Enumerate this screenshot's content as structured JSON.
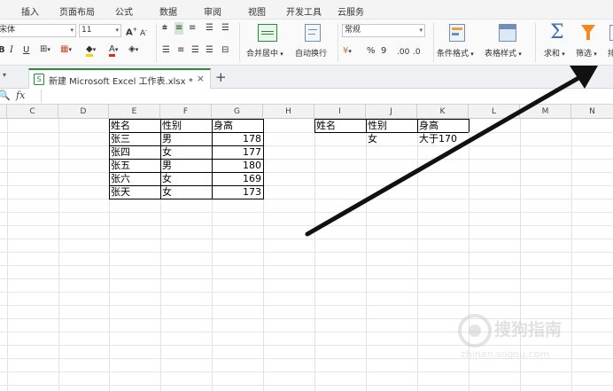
{
  "menu": [
    "插入",
    "页面布局",
    "公式",
    "数据",
    "审阅",
    "视图",
    "开发工具",
    "云服务"
  ],
  "ribbon": {
    "font_name": "宋体",
    "font_size": "11",
    "bold": "B",
    "italic": "I",
    "underline": "U",
    "font_color_letter": "A",
    "grow_font": "A",
    "shrink_font": "A",
    "merge_center": "合并居中",
    "wrap_text": "自动换行",
    "number_format": "常规",
    "percent": "%",
    "thousands": "9",
    "conditional_format": "条件格式",
    "table_style": "表格样式",
    "sum": "求和",
    "filter": "筛选",
    "sort_partial": "排"
  },
  "tab": {
    "title": "新建 Microsoft Excel 工作表.xlsx *",
    "close": "×",
    "add": "+"
  },
  "formula_bar": {
    "fx": "fx",
    "value": ""
  },
  "columns": [
    "C",
    "D",
    "E",
    "F",
    "G",
    "H",
    "I",
    "J",
    "K",
    "L",
    "M",
    "N"
  ],
  "table1": {
    "headers": [
      "姓名",
      "性别",
      "身高"
    ],
    "rows": [
      [
        "张三",
        "男",
        "178"
      ],
      [
        "张四",
        "女",
        "177"
      ],
      [
        "张五",
        "男",
        "180"
      ],
      [
        "张六",
        "女",
        "169"
      ],
      [
        "张天",
        "女",
        "173"
      ]
    ]
  },
  "criteria": {
    "headers": [
      "姓名",
      "性别",
      "身高"
    ],
    "row": [
      "",
      "女",
      "大于170"
    ]
  },
  "watermark": {
    "text": "搜狗指南",
    "url": "zhinan.sogou.com"
  },
  "colors": {
    "arrow": "#111111",
    "accent_green": "#2a8a3b",
    "filter_orange": "#f08a24"
  }
}
